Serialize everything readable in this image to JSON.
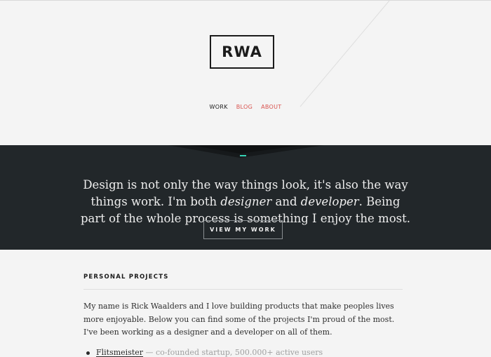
{
  "logo": {
    "text": "RWA"
  },
  "nav": {
    "items": [
      {
        "label": "WORK",
        "active": true
      },
      {
        "label": "BLOG",
        "active": false
      },
      {
        "label": "ABOUT",
        "active": false
      }
    ]
  },
  "hero": {
    "text_part1": "Design is not only the way things look, it's also the way things work. I'm both ",
    "em1": "designer",
    "text_part2": " and ",
    "em2": "developer",
    "text_part3": ". Being part of the whole process is something I enjoy the most.",
    "button_label": "VIEW MY WORK"
  },
  "projects": {
    "title": "PERSONAL PROJECTS",
    "intro": "My name is Rick Waalders and I love building products that make peoples lives more enjoyable. Below you can find some of the projects I'm proud of the most. I've been working as a designer and a developer on all of them.",
    "items": [
      {
        "name": "Flitsmeister",
        "description": " — co-founded startup, 500.000+ active users"
      }
    ]
  },
  "colors": {
    "accent_red": "#d9534f",
    "hero_bg": "#22272a",
    "hero_accent": "#36d3b4",
    "text_dark": "#1b1b1b"
  }
}
